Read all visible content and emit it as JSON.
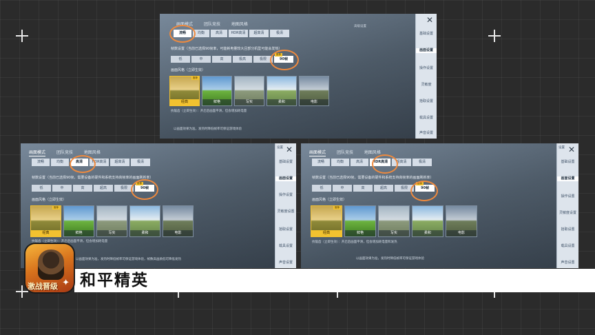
{
  "top": {
    "tabs": [
      {
        "label": "画面模式",
        "active": false
      },
      {
        "label": "团队竞技",
        "active": false
      },
      {
        "label": "地图风格",
        "active": false
      }
    ],
    "gear_tag": "高级设置",
    "quality": [
      {
        "label": "流畅",
        "active": true
      },
      {
        "label": "均衡",
        "active": false
      },
      {
        "label": "高清",
        "active": false
      },
      {
        "label": "HDR高清",
        "active": false
      },
      {
        "label": "超高清",
        "active": false
      },
      {
        "label": "极清",
        "active": false
      }
    ],
    "frame_label": "帧数设置（当前已选择90帧率，可能耗电量较大且部分机型可能会发热）",
    "frames": [
      {
        "label": "低",
        "active": false
      },
      {
        "label": "中",
        "active": false
      },
      {
        "label": "高",
        "active": false
      },
      {
        "label": "极高",
        "active": false
      },
      {
        "label": "极限",
        "active": false
      },
      {
        "label": "90帧",
        "active": true
      }
    ],
    "frame_badge": "推荐",
    "style_label": "画面风格（立即生效）",
    "styles": [
      {
        "label": "经典",
        "active": true
      },
      {
        "label": "鲜艳",
        "active": false
      },
      {
        "label": "写实",
        "active": false
      },
      {
        "label": "柔和",
        "active": false
      },
      {
        "label": "电影",
        "active": false
      }
    ],
    "style_badge": "推荐",
    "aa_label": "抗锯齿（立即生效）：开启后画面平滑，但会增加耗电量",
    "footer": "以画面效果为准，发热时降低帧率可保证游戏体验",
    "side": [
      {
        "label": "基础设置",
        "active": false
      },
      {
        "label": "画面设置",
        "active": true
      },
      {
        "label": "操作设置",
        "active": false
      },
      {
        "label": "灵敏度",
        "active": false
      },
      {
        "label": "拾取设置",
        "active": false
      },
      {
        "label": "载具设置",
        "active": false
      },
      {
        "label": "声音设置",
        "active": false
      }
    ]
  },
  "left": {
    "tabs": [
      {
        "label": "画面模式",
        "active": true
      },
      {
        "label": "团队竞技",
        "active": false
      },
      {
        "label": "地图风格",
        "active": false
      }
    ],
    "gear_tag": "设置",
    "quality": [
      {
        "label": "流畅",
        "active": false
      },
      {
        "label": "均衡",
        "active": false
      },
      {
        "label": "高清",
        "active": true
      },
      {
        "label": "HDR高清",
        "active": false
      },
      {
        "label": "超高清",
        "active": false
      },
      {
        "label": "极清",
        "active": false
      }
    ],
    "frame_label": "帧数设置（当前已选择90帧，需要设备的硬件和系统支持高帧率的画面刷新率）",
    "frames": [
      {
        "label": "低",
        "active": false
      },
      {
        "label": "中",
        "active": false
      },
      {
        "label": "高",
        "active": false
      },
      {
        "label": "超高",
        "active": false
      },
      {
        "label": "极限",
        "active": false
      },
      {
        "label": "90帧",
        "active": true
      }
    ],
    "frame_badge": "推荐",
    "style_label": "画面风格（立即生效）",
    "styles": [
      {
        "label": "经典",
        "active": true
      },
      {
        "label": "鲜艳",
        "active": false
      },
      {
        "label": "写实",
        "active": false
      },
      {
        "label": "柔和",
        "active": false
      },
      {
        "label": "电影",
        "active": false
      }
    ],
    "style_badge": "推荐",
    "aa_label": "抗锯齿（立即生效）：开启后画面平滑，但会增加耗电量",
    "footer": "以画面效果为准，发热时降低帧率可保证游戏体验，帧数高画质低可降低发热",
    "side": [
      {
        "label": "基础设置",
        "active": false
      },
      {
        "label": "画面设置",
        "active": true
      },
      {
        "label": "操作设置",
        "active": false
      },
      {
        "label": "灵敏度设置",
        "active": false
      },
      {
        "label": "拾取设置",
        "active": false
      },
      {
        "label": "载具设置",
        "active": false
      },
      {
        "label": "声音设置",
        "active": false
      }
    ]
  },
  "right": {
    "tabs": [
      {
        "label": "画面模式",
        "active": true
      },
      {
        "label": "团队竞技",
        "active": false
      },
      {
        "label": "地图风格",
        "active": false
      }
    ],
    "gear_tag": "设置",
    "quality": [
      {
        "label": "流畅",
        "active": false
      },
      {
        "label": "均衡",
        "active": false
      },
      {
        "label": "高清",
        "active": false
      },
      {
        "label": "HDR高清",
        "active": true
      },
      {
        "label": "超高清",
        "active": false
      },
      {
        "label": "极清",
        "active": false
      }
    ],
    "frame_label": "帧数设置（当前已选择90帧，需要设备的硬件和系统支持高帧率的画面刷新率）",
    "frames": [
      {
        "label": "低",
        "active": false
      },
      {
        "label": "中",
        "active": false
      },
      {
        "label": "高",
        "active": false
      },
      {
        "label": "超高",
        "active": false
      },
      {
        "label": "极限",
        "active": false
      },
      {
        "label": "90帧",
        "active": true
      }
    ],
    "frame_badge": "推荐",
    "style_label": "画面风格（立即生效）",
    "styles": [
      {
        "label": "经典",
        "active": true
      },
      {
        "label": "鲜艳",
        "active": false
      },
      {
        "label": "写实",
        "active": false
      },
      {
        "label": "柔和",
        "active": false
      },
      {
        "label": "电影",
        "active": false
      }
    ],
    "style_badge": "推荐",
    "aa_label": "抗锯齿（立即生效）：开启后画面平滑，但会增加耗电量和发热",
    "footer": "以画面效果为准，发热时降低帧率可保证游戏体验",
    "side": [
      {
        "label": "基础设置",
        "active": false
      },
      {
        "label": "画面设置",
        "active": true
      },
      {
        "label": "操作设置",
        "active": false
      },
      {
        "label": "灵敏度设置",
        "active": false
      },
      {
        "label": "拾取设置",
        "active": false
      },
      {
        "label": "载具设置",
        "active": false
      },
      {
        "label": "声音设置",
        "active": false
      }
    ]
  },
  "banner": {
    "title": "和平精英"
  },
  "icon": {
    "logo_text": "激战晋级",
    "star": "✦"
  }
}
